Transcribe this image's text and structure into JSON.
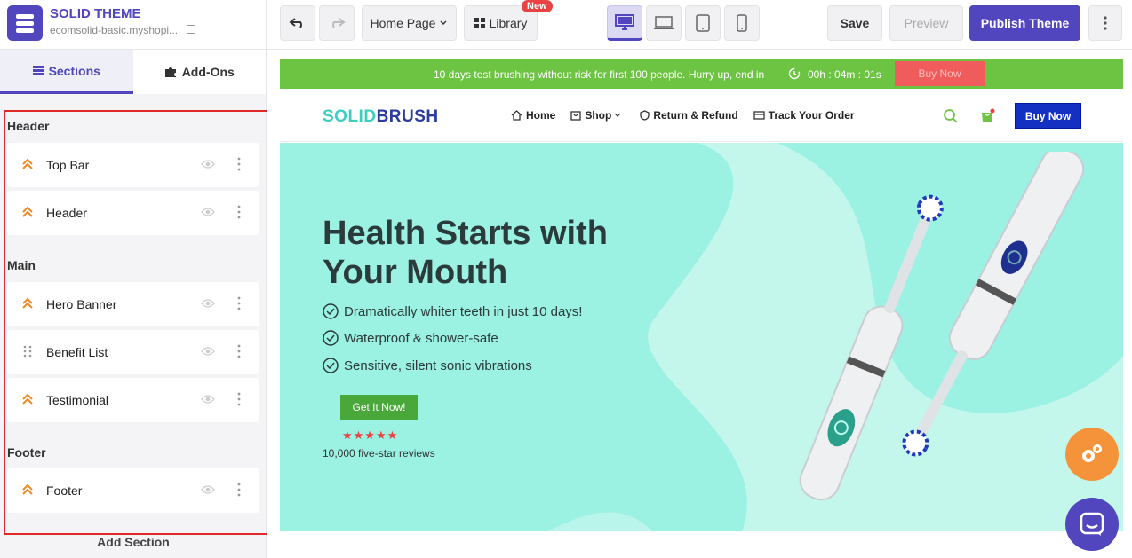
{
  "brand": {
    "title": "SOLID THEME",
    "subtitle": "ecomsolid-basic.myshopi..."
  },
  "toolbar": {
    "page_select": "Home Page",
    "library_label": "Library",
    "library_badge": "New",
    "save_label": "Save",
    "preview_label": "Preview",
    "publish_label": "Publish Theme",
    "active_device": "desktop"
  },
  "sidebar": {
    "tabs": [
      {
        "label": "Sections",
        "active": true
      },
      {
        "label": "Add-Ons",
        "active": false
      }
    ],
    "groups": [
      {
        "label": "Header",
        "items": [
          {
            "label": "Top Bar",
            "icon": "chevron-up-icon"
          },
          {
            "label": "Header",
            "icon": "chevron-up-icon"
          }
        ]
      },
      {
        "label": "Main",
        "items": [
          {
            "label": "Hero Banner",
            "icon": "chevron-up-icon"
          },
          {
            "label": "Benefit List",
            "icon": "drag-handle-icon"
          },
          {
            "label": "Testimonial",
            "icon": "chevron-up-icon"
          }
        ]
      },
      {
        "label": "Footer",
        "items": [
          {
            "label": "Footer",
            "icon": "chevron-up-icon"
          }
        ]
      }
    ],
    "add_section_label": "Add Section"
  },
  "preview": {
    "promo": {
      "text": "10 days test brushing without risk for first 100 people. Hurry up, end in",
      "timer": "00h : 04m : 01s",
      "button": "Buy Now"
    },
    "store_header": {
      "logo_part1": "SOLID",
      "logo_part2": "BRUSH",
      "nav": [
        "Home",
        "Shop",
        "Return & Refund",
        "Track Your Order"
      ],
      "buy_button": "Buy Now"
    },
    "hero": {
      "title": "Health Starts with Your Mouth",
      "features": [
        "Dramatically whiter teeth in just 10 days!",
        "Waterproof & shower-safe",
        "Sensitive, silent sonic vibrations"
      ],
      "cta": "Get It Now!",
      "rating": 4.5,
      "stars": "★★★★★",
      "reviews": "10,000 five-star reviews"
    }
  },
  "colors": {
    "accent": "#5146bd",
    "promo": "#6cc442",
    "hero_bg": "#9bf1e2",
    "highlight_box": "#e02a2a",
    "fab_orange": "#f5933b"
  }
}
